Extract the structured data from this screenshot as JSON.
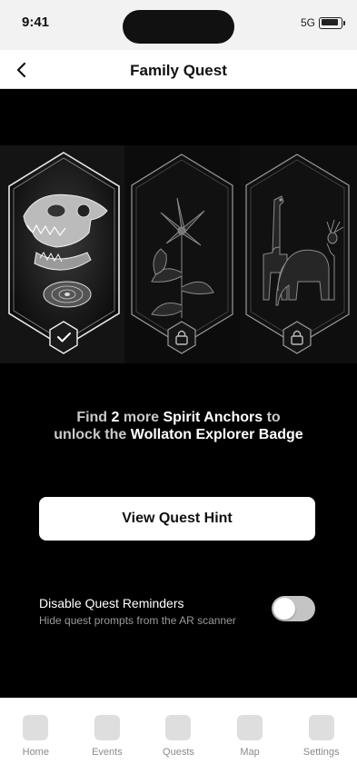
{
  "status_bar": {
    "time": "9:41",
    "network": "5G"
  },
  "nav": {
    "title": "Family Quest"
  },
  "anchors": [
    {
      "name": "Dinosaur fossil",
      "state": "found",
      "badge_icon": "check-icon"
    },
    {
      "name": "Flower",
      "state": "locked",
      "badge_icon": "lock-icon"
    },
    {
      "name": "Animals",
      "state": "locked",
      "badge_icon": "lock-icon"
    }
  ],
  "progress": {
    "prefix": "Find",
    "count": "2",
    "middle": "more",
    "item": "Spirit Anchors",
    "to": "to",
    "line2_prefix": "unlock the",
    "badge": "Wollaton Explorer Badge"
  },
  "hint_button": {
    "label": "View Quest Hint"
  },
  "setting": {
    "label": "Disable Quest Reminders",
    "description": "Hide quest prompts from the AR scanner",
    "enabled": false
  },
  "tabs": [
    {
      "label": "Home"
    },
    {
      "label": "Events"
    },
    {
      "label": "Quests"
    },
    {
      "label": "Map"
    },
    {
      "label": "Settings"
    }
  ]
}
